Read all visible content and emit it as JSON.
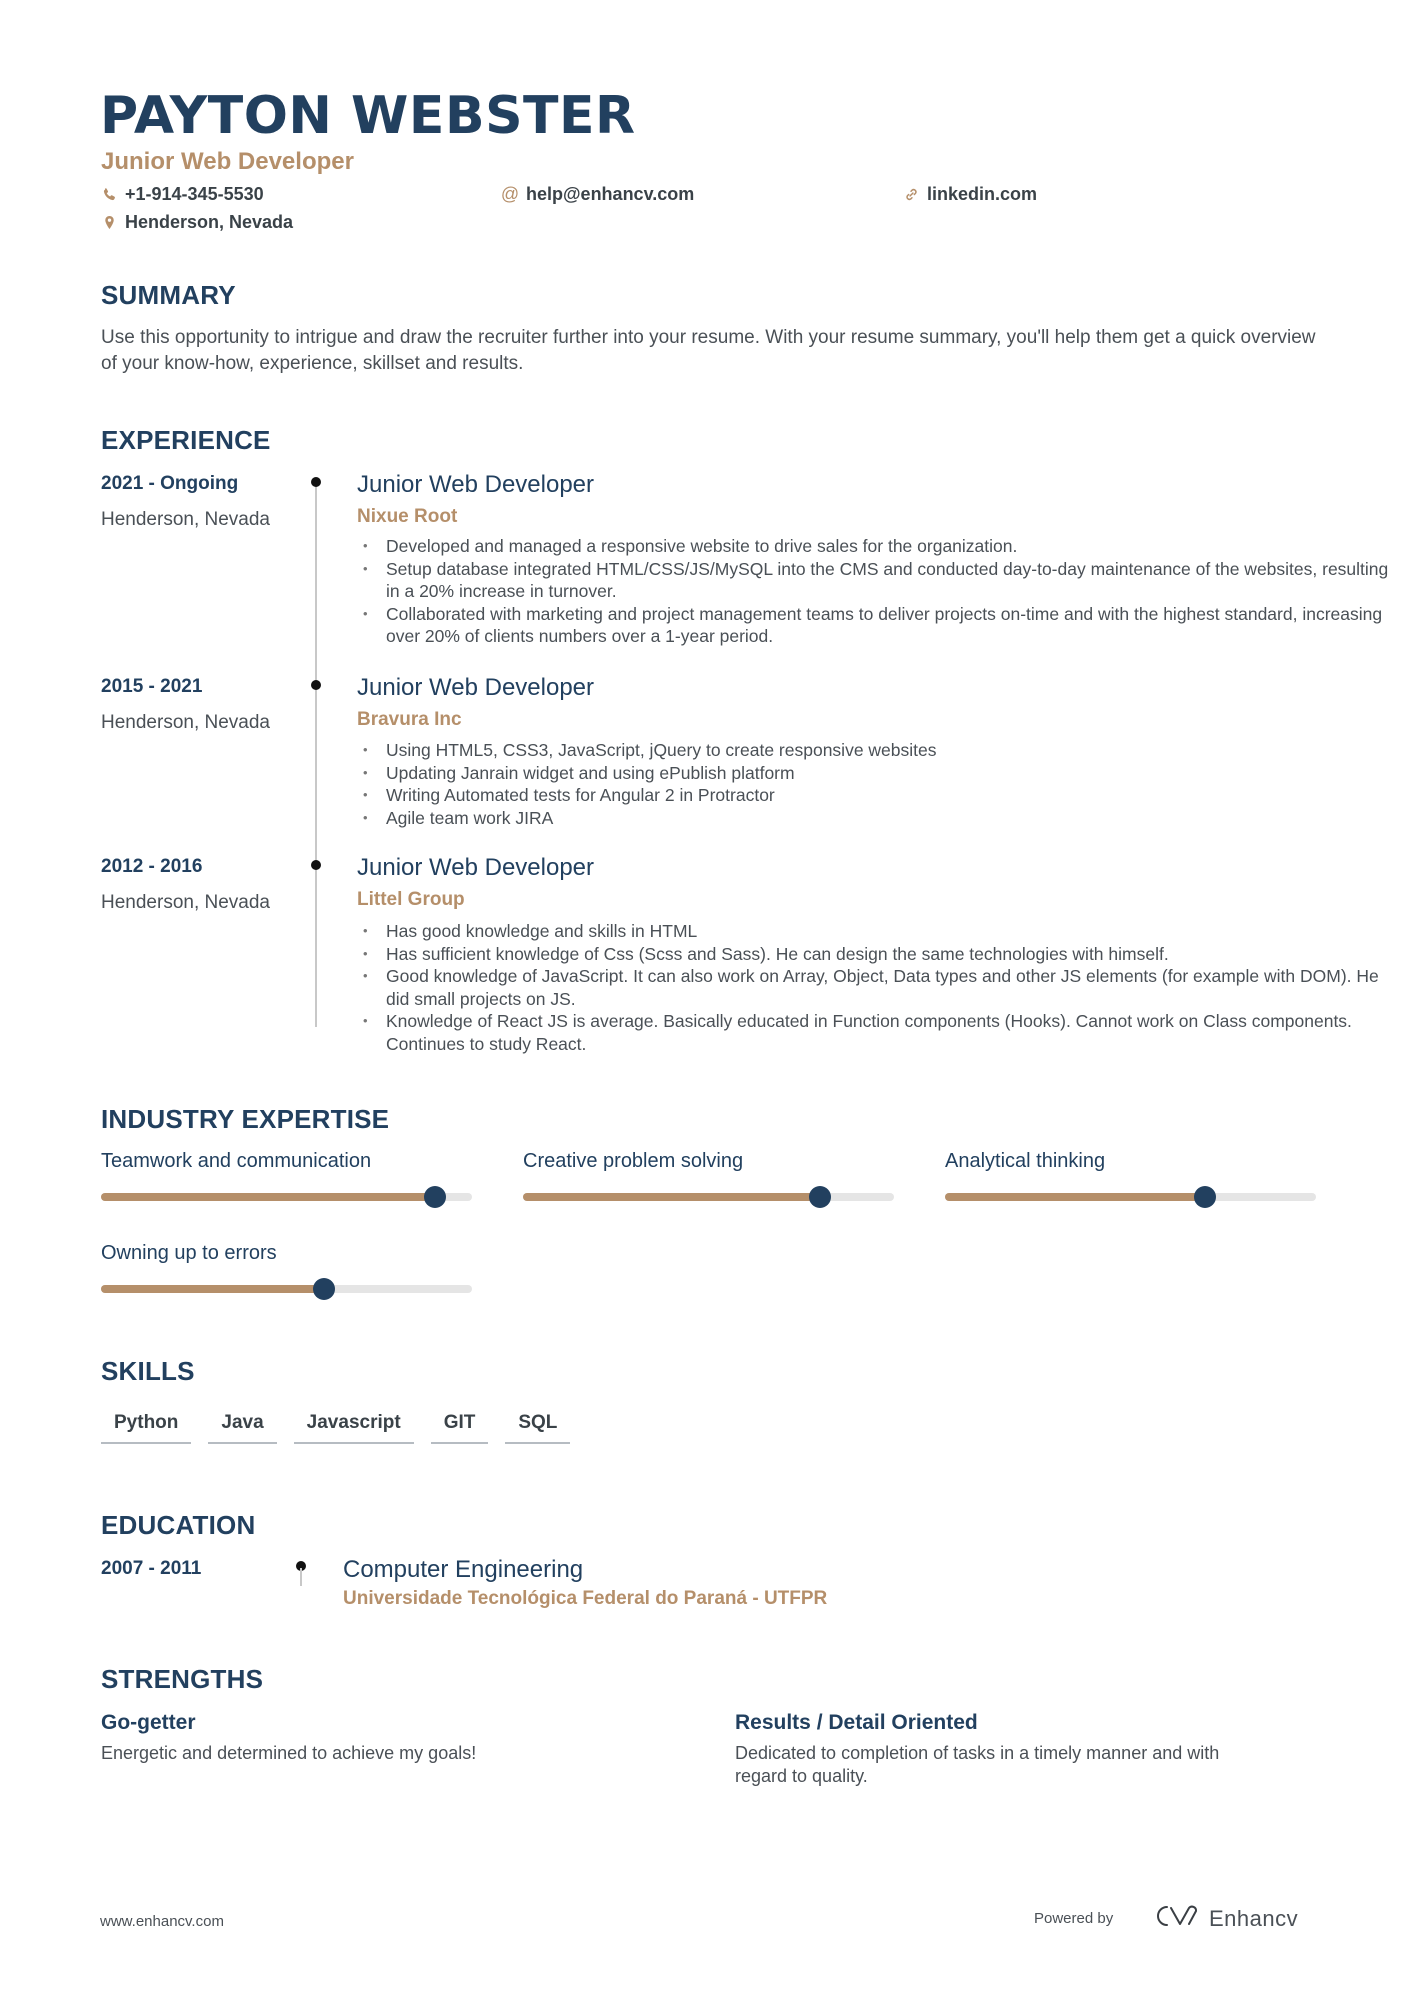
{
  "header": {
    "name": "PAYTON WEBSTER",
    "title": "Junior Web Developer",
    "contacts": [
      {
        "icon": "phone-icon",
        "value": "+1-914-345-5530"
      },
      {
        "icon": "at-icon",
        "value": "help@enhancv.com"
      },
      {
        "icon": "link-icon",
        "value": "linkedin.com"
      },
      {
        "icon": "location-pin-icon",
        "value": "Henderson, Nevada"
      }
    ]
  },
  "summary": {
    "title": "SUMMARY",
    "text": "Use this opportunity to intrigue and draw the recruiter further into your resume. With your resume summary, you'll help them get a quick overview of your know-how, experience, skillset and results."
  },
  "experience": {
    "title": "EXPERIENCE",
    "items": [
      {
        "dates": "2021 - Ongoing",
        "location": "Henderson, Nevada",
        "role": "Junior Web Developer",
        "company": "Nixue Root",
        "bullets": [
          "Developed and managed a responsive website to drive sales for the organization.",
          "Setup database integrated HTML/CSS/JS/MySQL into the CMS and conducted day-to-day maintenance of the websites, resulting in a 20% increase in turnover.",
          "Collaborated with marketing and project management teams to deliver projects on-time and with the highest standard, increasing over 20% of clients numbers over a 1-year period."
        ]
      },
      {
        "dates": "2015 - 2021",
        "location": "Henderson, Nevada",
        "role": "Junior Web Developer",
        "company": "Bravura Inc",
        "bullets": [
          "Using HTML5, CSS3, JavaScript, jQuery to create responsive websites",
          "Updating Janrain widget and using ePublish platform",
          "Writing Automated tests for Angular 2 in Protractor",
          "Agile team work JIRA"
        ]
      },
      {
        "dates": "2012 - 2016",
        "location": "Henderson, Nevada",
        "role": "Junior Web Developer",
        "company": "Littel Group",
        "bullets": [
          "Has good knowledge and skills in HTML",
          "Has sufficient knowledge of Css (Scss and Sass). He can design the same technologies with himself.",
          "Good knowledge of JavaScript. It can also work on Array, Object, Data types and other JS elements (for example with DOM). He did small projects on JS.",
          "Knowledge of React JS is average. Basically educated in Function components (Hooks). Cannot work on Class components. Continues to study React."
        ]
      }
    ]
  },
  "expertise": {
    "title": "INDUSTRY EXPERTISE",
    "items": [
      {
        "label": "Teamwork and communication",
        "level": 0.9
      },
      {
        "label": "Creative problem solving",
        "level": 0.8
      },
      {
        "label": "Analytical thinking",
        "level": 0.7
      },
      {
        "label": "Owning up to errors",
        "level": 0.6
      }
    ]
  },
  "skills": {
    "title": "SKILLS",
    "items": [
      "Python",
      "Java",
      "Javascript",
      "GIT",
      "SQL"
    ]
  },
  "education": {
    "title": "EDUCATION",
    "items": [
      {
        "dates": "2007 - 2011",
        "degree": "Computer Engineering",
        "school": "Universidade Tecnológica Federal do Paraná - UTFPR"
      }
    ]
  },
  "strengths": {
    "title": "STRENGTHS",
    "items": [
      {
        "title": "Go-getter",
        "text": "Energetic and determined to achieve my goals!"
      },
      {
        "title": "Results / Detail Oriented",
        "text": "Dedicated to completion of tasks in a timely manner and with regard to quality."
      }
    ]
  },
  "footer": {
    "website": "www.enhancv.com",
    "powered_by": "Powered by",
    "brand": "Enhancv"
  },
  "colors": {
    "primary": "#22405f",
    "accent": "#b58f6a",
    "track": "#e5e5e5"
  }
}
